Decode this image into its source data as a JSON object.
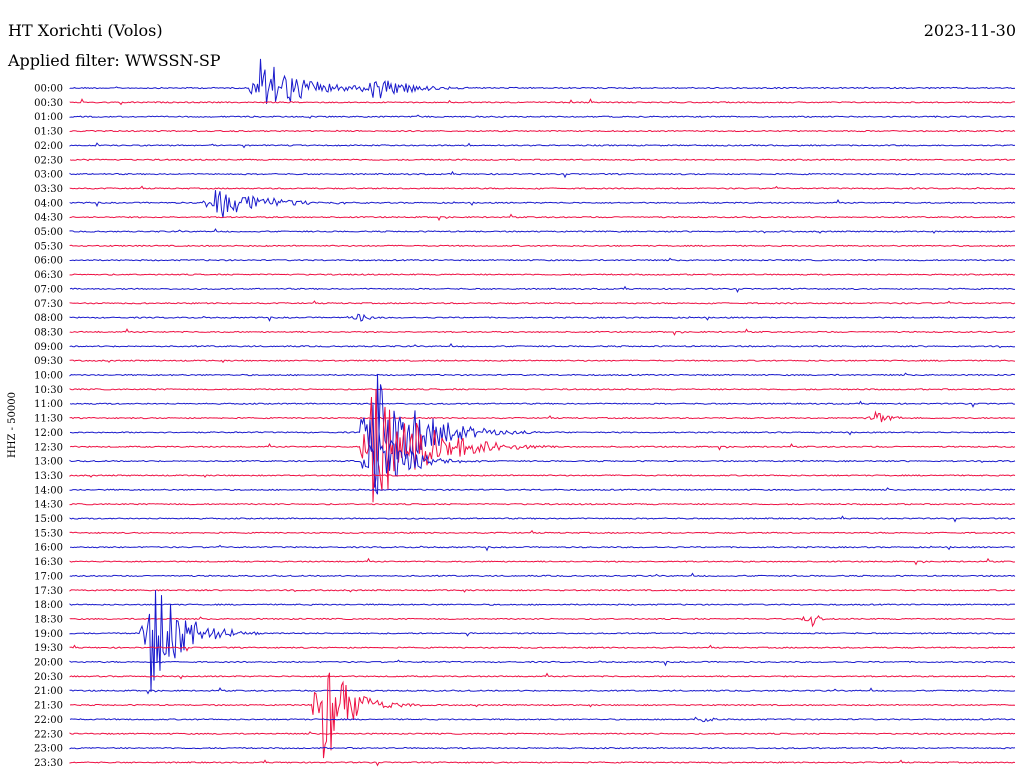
{
  "chart_data": {
    "type": "line",
    "title": "HT Xorichti (Volos)",
    "subtitle": "Applied filter: WWSSN-SP",
    "date": "2023-11-30",
    "ylabel": "HHZ - 50000",
    "tick_labels": [
      "00:00",
      "00:30",
      "01:00",
      "01:30",
      "02:00",
      "02:30",
      "03:00",
      "03:30",
      "04:00",
      "04:30",
      "05:00",
      "05:30",
      "06:00",
      "06:30",
      "07:00",
      "07:30",
      "08:00",
      "08:30",
      "09:00",
      "09:30",
      "10:00",
      "10:30",
      "11:00",
      "11:30",
      "12:00",
      "12:30",
      "13:00",
      "13:30",
      "14:00",
      "14:30",
      "15:00",
      "15:30",
      "16:00",
      "16:30",
      "17:00",
      "17:30",
      "18:00",
      "18:30",
      "19:00",
      "19:30",
      "20:00",
      "20:30",
      "21:00",
      "21:30",
      "22:00",
      "22:30",
      "23:00",
      "23:30"
    ],
    "line_colors": [
      "#1a1acc",
      "#ee1144"
    ],
    "x_minutes_per_line": 30,
    "events": [
      {
        "line": 0,
        "minute": 6.0,
        "amplitude": 2.4,
        "duration": 3.0
      },
      {
        "line": 0,
        "minute": 9.5,
        "amplitude": 1.2,
        "duration": 2.5
      },
      {
        "line": 8,
        "minute": 4.5,
        "amplitude": 1.4,
        "duration": 3.5
      },
      {
        "line": 16,
        "minute": 9.1,
        "amplitude": 0.5,
        "duration": 0.8
      },
      {
        "line": 23,
        "minute": 25.5,
        "amplitude": 0.6,
        "duration": 1.0
      },
      {
        "line": 24,
        "minute": 9.5,
        "amplitude": 5.0,
        "duration": 3.5
      },
      {
        "line": 25,
        "minute": 9.5,
        "amplitude": 5.0,
        "duration": 4.0
      },
      {
        "line": 26,
        "minute": 9.5,
        "amplitude": 3.0,
        "duration": 2.5
      },
      {
        "line": 37,
        "minute": 23.5,
        "amplitude": 0.8,
        "duration": 0.5
      },
      {
        "line": 38,
        "minute": 2.5,
        "amplitude": 4.5,
        "duration": 2.5
      },
      {
        "line": 43,
        "minute": 8.0,
        "amplitude": 4.5,
        "duration": 2.0
      },
      {
        "line": 44,
        "minute": 20.0,
        "amplitude": 0.6,
        "duration": 0.5
      }
    ]
  }
}
